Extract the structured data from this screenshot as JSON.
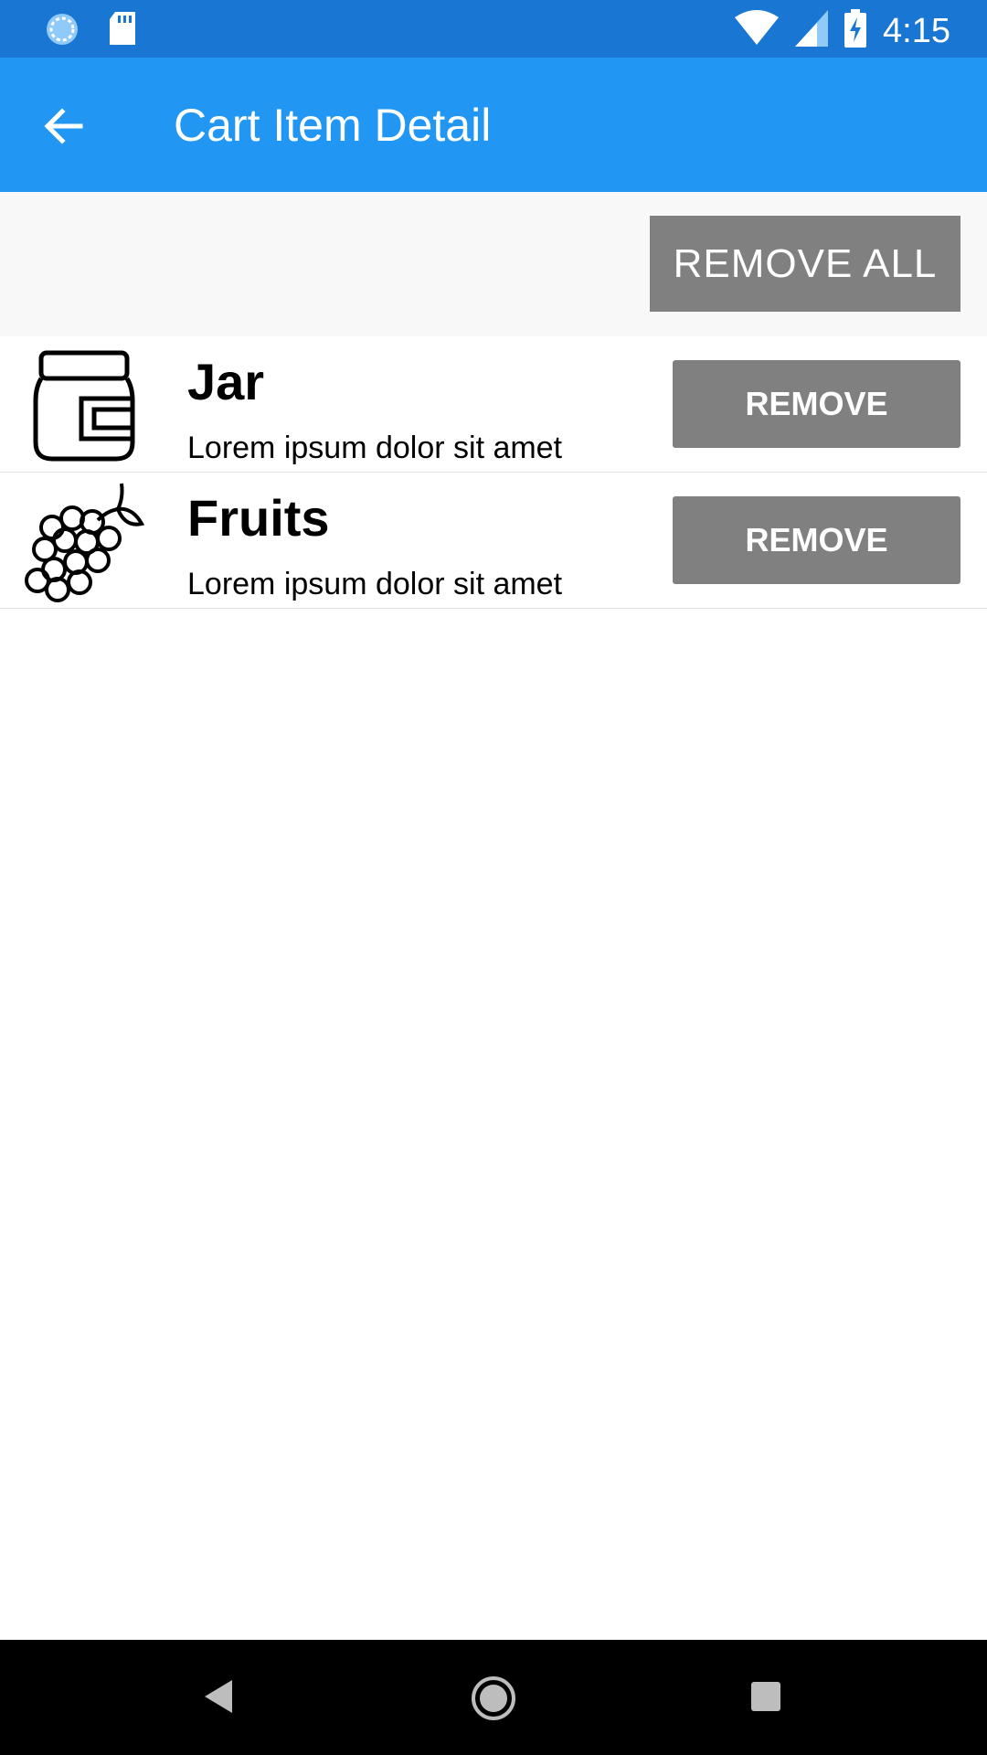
{
  "status_bar": {
    "time": "4:15",
    "icons": [
      "sync-icon",
      "sd-card-icon",
      "wifi-icon",
      "signal-icon",
      "battery-charging-icon"
    ]
  },
  "app_bar": {
    "title": "Cart Item Detail",
    "back_icon": "arrow-back-icon"
  },
  "toolbar": {
    "remove_all_label": "REMOVE ALL"
  },
  "items": [
    {
      "name": "Jar",
      "description": "Lorem ipsum dolor sit amet",
      "icon": "jar-icon",
      "remove_label": "REMOVE"
    },
    {
      "name": "Fruits",
      "description": "Lorem ipsum dolor sit amet",
      "icon": "grapes-icon",
      "remove_label": "REMOVE"
    }
  ],
  "nav_bar": {
    "icons": [
      "nav-back-icon",
      "nav-home-icon",
      "nav-recents-icon"
    ]
  },
  "colors": {
    "status_bar": "#1976d2",
    "app_bar": "#2196f3",
    "button": "#808080"
  }
}
